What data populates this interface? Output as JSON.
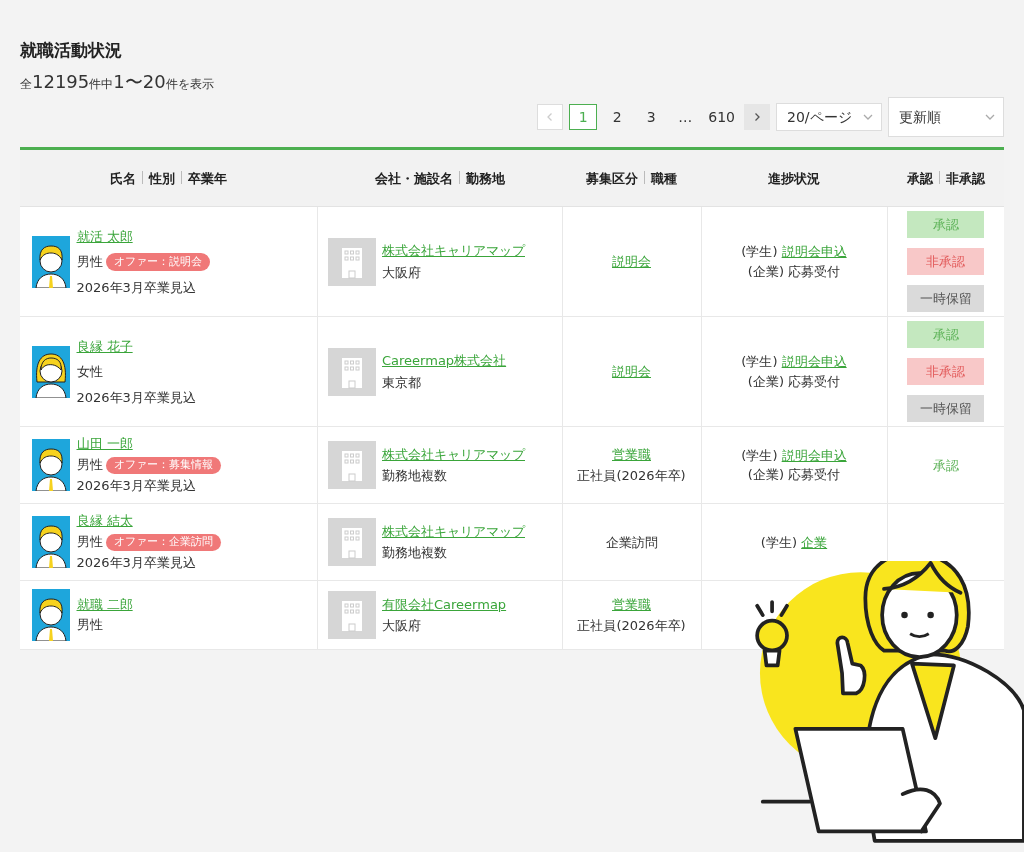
{
  "page": {
    "title": "就職活動状況",
    "summary": [
      {
        "text": "全",
        "kind": "small"
      },
      {
        "text": "12195",
        "kind": "big"
      },
      {
        "text": "件中",
        "kind": "small"
      },
      {
        "text": "1〜20",
        "kind": "big"
      },
      {
        "text": "件を表示",
        "kind": "small"
      }
    ]
  },
  "pagination": {
    "prev": {
      "disabled": true
    },
    "pages": [
      {
        "label": "1",
        "kind": "page",
        "selected": true
      },
      {
        "label": "2",
        "kind": "page",
        "selected": false
      },
      {
        "label": "3",
        "kind": "page",
        "selected": false
      },
      {
        "label": "…",
        "kind": "ellipsis"
      },
      {
        "label": "610",
        "kind": "page",
        "selected": false
      }
    ],
    "next": {
      "disabled": false
    },
    "per_page": "20/ページ",
    "sort": "更新順"
  },
  "table": {
    "columns": [
      [
        "氏名",
        "性別",
        "卒業年"
      ],
      [
        "会社・施設名",
        "勤務地"
      ],
      [
        "募集区分",
        "職種"
      ],
      [
        "進捗状況"
      ],
      [
        "承認",
        "非承認"
      ]
    ],
    "rows": [
      {
        "long_hair": false,
        "name": "就活 太郎",
        "gender": "男性",
        "offer": "オファー：説明会",
        "graduation": "2026年3月卒業見込",
        "company": "株式会社キャリアマップ",
        "location": "大阪府",
        "category": {
          "text": "説明会",
          "link": true
        },
        "progress": {
          "student_label": "(学生)",
          "student_link": "説明会申込",
          "company_label": "(企業)",
          "company_status": "応募受付"
        },
        "approval": [
          {
            "label": "承認",
            "kind": "approve"
          },
          {
            "label": "非承認",
            "kind": "reject"
          },
          {
            "label": "一時保留",
            "kind": "hold"
          }
        ]
      },
      {
        "long_hair": true,
        "name": "良縁 花子",
        "gender": "女性",
        "graduation": "2026年3月卒業見込",
        "company": "Careermap株式会社",
        "location": "東京都",
        "category": {
          "text": "説明会",
          "link": true
        },
        "progress": {
          "student_label": "(学生)",
          "student_link": "説明会申込",
          "company_label": "(企業)",
          "company_status": "応募受付"
        },
        "approval": [
          {
            "label": "承認",
            "kind": "approve"
          },
          {
            "label": "非承認",
            "kind": "reject"
          },
          {
            "label": "一時保留",
            "kind": "hold"
          }
        ]
      },
      {
        "long_hair": false,
        "name": "山田 一郎",
        "gender": "男性",
        "offer": "オファー：募集情報",
        "graduation": "2026年3月卒業見込",
        "company": "株式会社キャリアマップ",
        "location": "勤務地複数",
        "category": {
          "text": "営業職",
          "link": true
        },
        "employment": "正社員(2026年卒)",
        "progress": {
          "student_label": "(学生)",
          "student_link": "説明会申込",
          "company_label": "(企業)",
          "company_status": "応募受付"
        },
        "approval": [
          {
            "label": "承認",
            "kind": "status"
          }
        ]
      },
      {
        "long_hair": false,
        "name": "良縁 結太",
        "gender": "男性",
        "offer": "オファー：企業訪問",
        "graduation": "2026年3月卒業見込",
        "company": "株式会社キャリアマップ",
        "location": "勤務地複数",
        "category": {
          "text": "企業訪問",
          "link": false
        },
        "progress": {
          "student_label": "(学生)",
          "student_link": "企業"
        }
      },
      {
        "long_hair": false,
        "name": "就職 二郎",
        "gender": "男性",
        "company": "有限会社Careermap",
        "location": "大阪府",
        "category": {
          "text": "営業職",
          "link": true
        },
        "employment": "正社員(2026年卒)"
      }
    ]
  }
}
